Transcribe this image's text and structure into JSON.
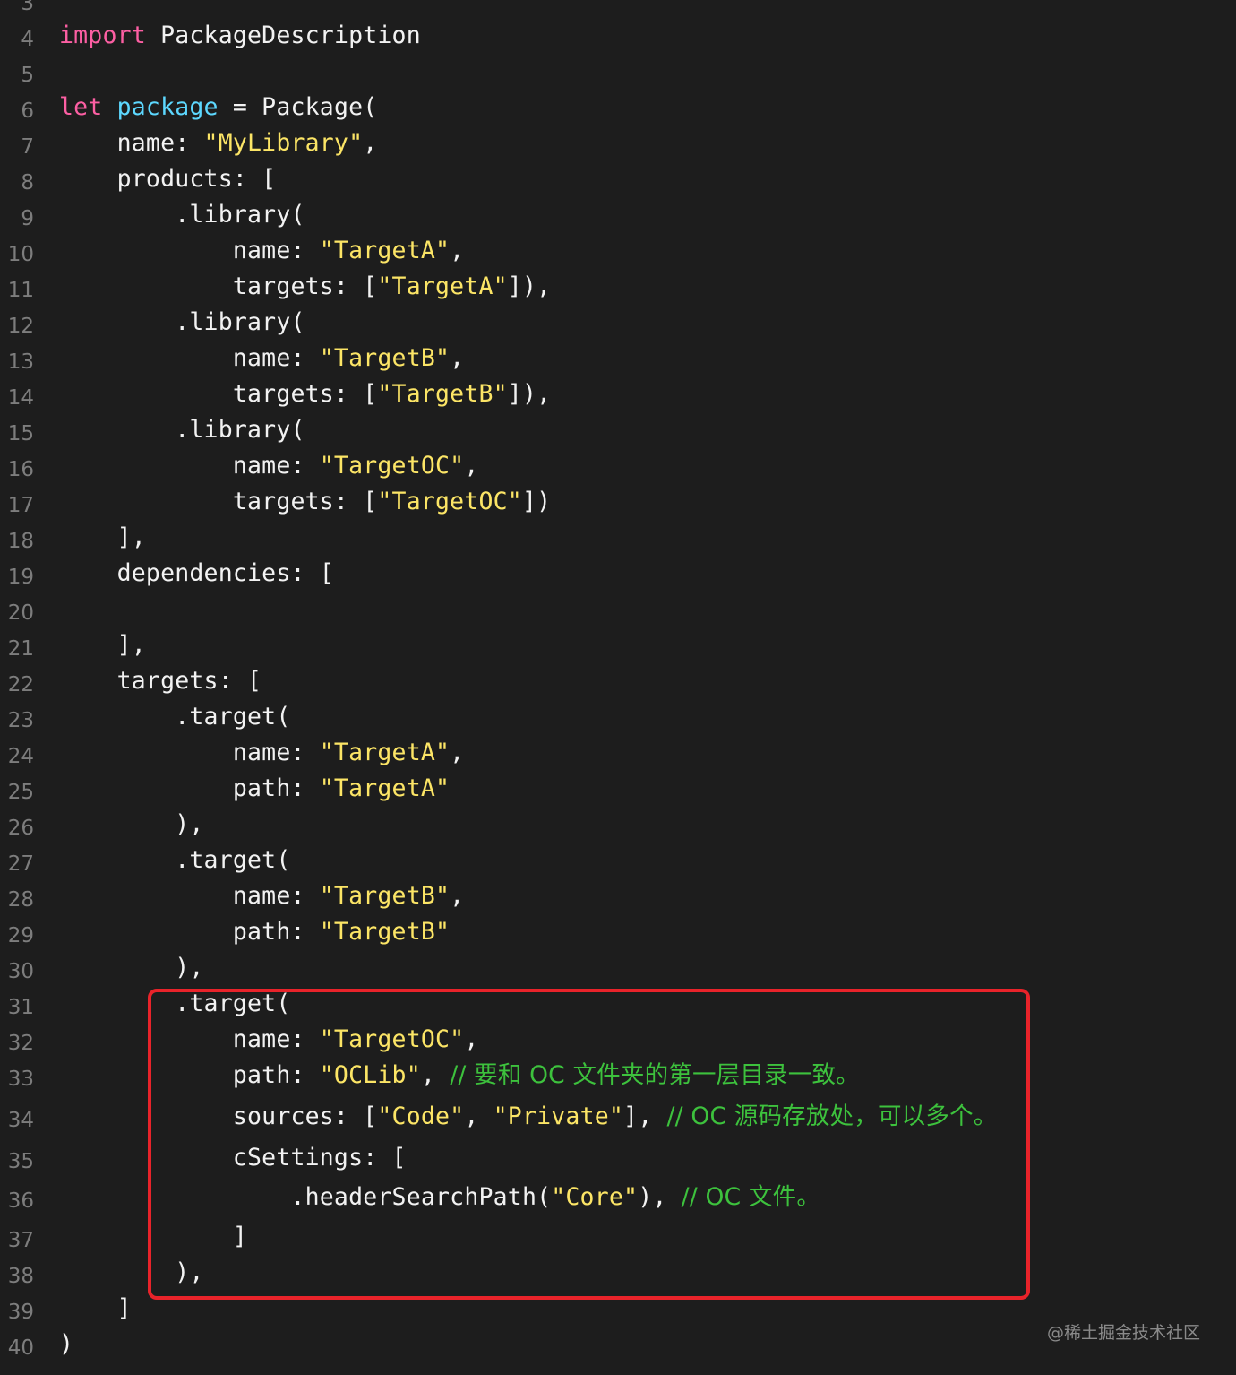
{
  "editor": {
    "colors": {
      "background": "#1d1d1d",
      "keyword": "#fc5fa3",
      "type": "#5dd8ff",
      "plain": "#f2f2f2",
      "string": "#fce566",
      "comment": "#3dc23d",
      "line_number": "#7d7d7d",
      "highlight_border": "#e8232a"
    },
    "lines": [
      {
        "n": "3",
        "tokens": []
      },
      {
        "n": "4",
        "tokens": [
          {
            "t": "import",
            "c": "kw"
          },
          {
            "t": " PackageDescription",
            "c": "pl"
          }
        ]
      },
      {
        "n": "5",
        "tokens": []
      },
      {
        "n": "6",
        "tokens": [
          {
            "t": "let",
            "c": "kw"
          },
          {
            "t": " ",
            "c": "pl"
          },
          {
            "t": "package",
            "c": "ty"
          },
          {
            "t": " = Package(",
            "c": "pl"
          }
        ]
      },
      {
        "n": "7",
        "tokens": [
          {
            "t": "    name: ",
            "c": "pl"
          },
          {
            "t": "\"MyLibrary\"",
            "c": "str"
          },
          {
            "t": ",",
            "c": "pl"
          }
        ]
      },
      {
        "n": "8",
        "tokens": [
          {
            "t": "    products: [",
            "c": "pl"
          }
        ]
      },
      {
        "n": "9",
        "tokens": [
          {
            "t": "        .library(",
            "c": "pl"
          }
        ]
      },
      {
        "n": "10",
        "tokens": [
          {
            "t": "            name: ",
            "c": "pl"
          },
          {
            "t": "\"TargetA\"",
            "c": "str"
          },
          {
            "t": ",",
            "c": "pl"
          }
        ]
      },
      {
        "n": "11",
        "tokens": [
          {
            "t": "            targets: [",
            "c": "pl"
          },
          {
            "t": "\"TargetA\"",
            "c": "str"
          },
          {
            "t": "]),",
            "c": "pl"
          }
        ]
      },
      {
        "n": "12",
        "tokens": [
          {
            "t": "        .library(",
            "c": "pl"
          }
        ]
      },
      {
        "n": "13",
        "tokens": [
          {
            "t": "            name: ",
            "c": "pl"
          },
          {
            "t": "\"TargetB\"",
            "c": "str"
          },
          {
            "t": ",",
            "c": "pl"
          }
        ]
      },
      {
        "n": "14",
        "tokens": [
          {
            "t": "            targets: [",
            "c": "pl"
          },
          {
            "t": "\"TargetB\"",
            "c": "str"
          },
          {
            "t": "]),",
            "c": "pl"
          }
        ]
      },
      {
        "n": "15",
        "tokens": [
          {
            "t": "        .library(",
            "c": "pl"
          }
        ]
      },
      {
        "n": "16",
        "tokens": [
          {
            "t": "            name: ",
            "c": "pl"
          },
          {
            "t": "\"TargetOC\"",
            "c": "str"
          },
          {
            "t": ",",
            "c": "pl"
          }
        ]
      },
      {
        "n": "17",
        "tokens": [
          {
            "t": "            targets: [",
            "c": "pl"
          },
          {
            "t": "\"TargetOC\"",
            "c": "str"
          },
          {
            "t": "])",
            "c": "pl"
          }
        ]
      },
      {
        "n": "18",
        "tokens": [
          {
            "t": "    ],",
            "c": "pl"
          }
        ]
      },
      {
        "n": "19",
        "tokens": [
          {
            "t": "    dependencies: [",
            "c": "pl"
          }
        ]
      },
      {
        "n": "20",
        "tokens": []
      },
      {
        "n": "21",
        "tokens": [
          {
            "t": "    ],",
            "c": "pl"
          }
        ]
      },
      {
        "n": "22",
        "tokens": [
          {
            "t": "    targets: [",
            "c": "pl"
          }
        ]
      },
      {
        "n": "23",
        "tokens": [
          {
            "t": "        .target(",
            "c": "pl"
          }
        ]
      },
      {
        "n": "24",
        "tokens": [
          {
            "t": "            name: ",
            "c": "pl"
          },
          {
            "t": "\"TargetA\"",
            "c": "str"
          },
          {
            "t": ",",
            "c": "pl"
          }
        ]
      },
      {
        "n": "25",
        "tokens": [
          {
            "t": "            path: ",
            "c": "pl"
          },
          {
            "t": "\"TargetA\"",
            "c": "str"
          }
        ]
      },
      {
        "n": "26",
        "tokens": [
          {
            "t": "        ),",
            "c": "pl"
          }
        ]
      },
      {
        "n": "27",
        "tokens": [
          {
            "t": "        .target(",
            "c": "pl"
          }
        ]
      },
      {
        "n": "28",
        "tokens": [
          {
            "t": "            name: ",
            "c": "pl"
          },
          {
            "t": "\"TargetB\"",
            "c": "str"
          },
          {
            "t": ",",
            "c": "pl"
          }
        ]
      },
      {
        "n": "29",
        "tokens": [
          {
            "t": "            path: ",
            "c": "pl"
          },
          {
            "t": "\"TargetB\"",
            "c": "str"
          }
        ]
      },
      {
        "n": "30",
        "tokens": [
          {
            "t": "        ),",
            "c": "pl"
          }
        ]
      },
      {
        "n": "31",
        "tokens": [
          {
            "t": "        .target(",
            "c": "pl"
          }
        ]
      },
      {
        "n": "32",
        "tokens": [
          {
            "t": "            name: ",
            "c": "pl"
          },
          {
            "t": "\"TargetOC\"",
            "c": "str"
          },
          {
            "t": ",",
            "c": "pl"
          }
        ]
      },
      {
        "n": "33",
        "tokens": [
          {
            "t": "            path: ",
            "c": "pl"
          },
          {
            "t": "\"OCLib\"",
            "c": "str"
          },
          {
            "t": ", ",
            "c": "pl"
          },
          {
            "t": "// 要和 OC 文件夹的第一层目录一致。",
            "c": "cm"
          }
        ]
      },
      {
        "n": "34",
        "tokens": [
          {
            "t": "            sources: [",
            "c": "pl"
          },
          {
            "t": "\"Code\"",
            "c": "str"
          },
          {
            "t": ", ",
            "c": "pl"
          },
          {
            "t": "\"Private\"",
            "c": "str"
          },
          {
            "t": "], ",
            "c": "pl"
          },
          {
            "t": "// OC 源码存放处，可以多个。",
            "c": "cm"
          }
        ]
      },
      {
        "n": "35",
        "tokens": [
          {
            "t": "            cSettings: [",
            "c": "pl"
          }
        ]
      },
      {
        "n": "36",
        "tokens": [
          {
            "t": "                .headerSearchPath(",
            "c": "pl"
          },
          {
            "t": "\"Core\"",
            "c": "str"
          },
          {
            "t": "), ",
            "c": "pl"
          },
          {
            "t": "// OC 文件。",
            "c": "cm"
          }
        ]
      },
      {
        "n": "37",
        "tokens": [
          {
            "t": "            ]",
            "c": "pl"
          }
        ]
      },
      {
        "n": "38",
        "tokens": [
          {
            "t": "        ),",
            "c": "pl"
          }
        ]
      },
      {
        "n": "39",
        "tokens": [
          {
            "t": "    ]",
            "c": "pl"
          }
        ]
      },
      {
        "n": "40",
        "tokens": [
          {
            "t": ")",
            "c": "pl"
          }
        ]
      }
    ]
  },
  "watermark": "@稀土掘金技术社区"
}
